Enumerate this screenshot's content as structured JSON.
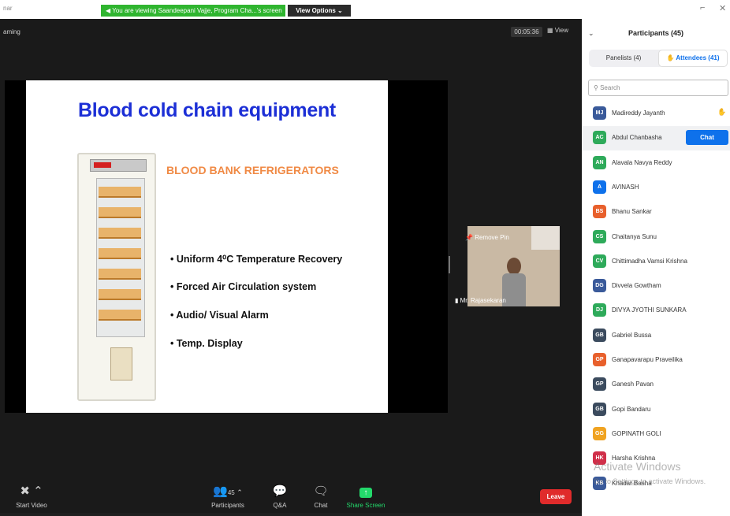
{
  "window": {
    "title_fragment": "nar"
  },
  "banner": {
    "text": "You are viewing Saandeepani Vajje, Program Cha...'s screen",
    "view_options": "View Options ⌄"
  },
  "meeting": {
    "recording_label": "aming",
    "timer": "00:05:36",
    "view_label": "View"
  },
  "slide": {
    "title": "Blood cold chain equipment",
    "subheading": "BLOOD BANK REFRIGERATORS",
    "bullets": [
      "• Uniform 4⁰C Temperature Recovery",
      "• Forced Air Circulation system",
      "• Audio/ Visual Alarm",
      "• Temp. Display"
    ]
  },
  "video": {
    "pin_label": "Remove Pin",
    "name": "Mr. Rajasekaran"
  },
  "toolbar": {
    "start_video": "Start Video",
    "participants": "Participants",
    "participants_count": "45",
    "qa": "Q&A",
    "chat": "Chat",
    "share_screen": "Share Screen",
    "leave": "Leave"
  },
  "panel": {
    "title": "Participants (45)",
    "tab_panelists": "Panelists (4)",
    "tab_attendees": "Attendees (41)",
    "search_placeholder": "Search",
    "chat_button": "Chat",
    "participants": [
      {
        "initials": "MJ",
        "name": "Madireddy Jayanth",
        "color": "#3a5a9a"
      },
      {
        "initials": "AC",
        "name": "Abdul Chanbasha",
        "color": "#2eaa5a"
      },
      {
        "initials": "AN",
        "name": "Alavala Navya Reddy",
        "color": "#2eaa5a"
      },
      {
        "initials": "A",
        "name": "AVINASH",
        "color": "#0e71eb"
      },
      {
        "initials": "BS",
        "name": "Bhanu Sankar",
        "color": "#e8602c"
      },
      {
        "initials": "CS",
        "name": "Chaitanya Sunu",
        "color": "#2eaa5a"
      },
      {
        "initials": "CV",
        "name": "Chittimadha Vamsi Krishna",
        "color": "#2eaa5a"
      },
      {
        "initials": "DG",
        "name": "Divvela Gowtham",
        "color": "#3a5a9a"
      },
      {
        "initials": "DJ",
        "name": "DIVYA JYOTHI SUNKARA",
        "color": "#2eaa5a"
      },
      {
        "initials": "GB",
        "name": "Gabriel Bussa",
        "color": "#3b4b5e"
      },
      {
        "initials": "GP",
        "name": "Ganapavarapu Praveilika",
        "color": "#e8602c"
      },
      {
        "initials": "GP",
        "name": "Ganesh Pavan",
        "color": "#3b4b5e"
      },
      {
        "initials": "GB",
        "name": "Gopi Bandaru",
        "color": "#3b4b5e"
      },
      {
        "initials": "GG",
        "name": "GOPINATH GOLI",
        "color": "#f0a321"
      },
      {
        "initials": "HK",
        "name": "Harsha Krishna",
        "color": "#d0304a"
      },
      {
        "initials": "KB",
        "name": "Khadar Basha",
        "color": "#3a5a9a"
      }
    ]
  },
  "watermark": {
    "line1": "Activate Windows",
    "line2": "Go to Settings to activate Windows."
  }
}
